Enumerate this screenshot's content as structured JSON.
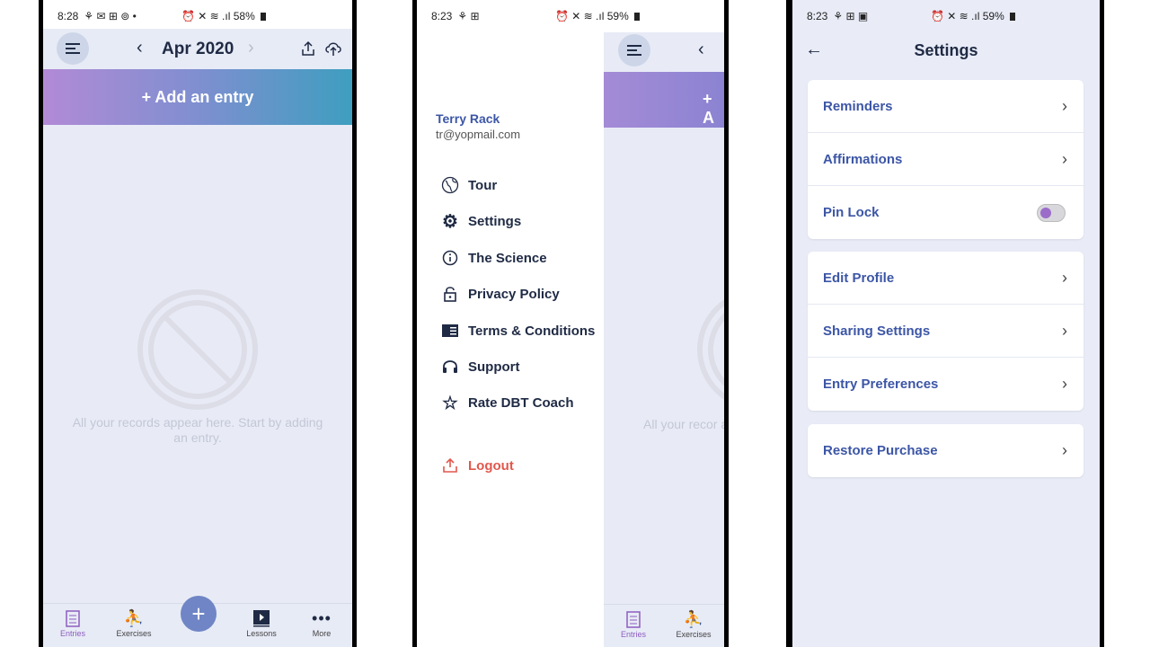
{
  "screen1": {
    "status": {
      "time": "8:28",
      "icons": "⚘ ✉ ⊞ ⊚ •",
      "right": "⏰ ✕ ≋ .ıl 58%"
    },
    "header": {
      "month": "Apr 2020",
      "prev": "‹",
      "next": "›"
    },
    "add_entry": "+ Add an entry",
    "empty_text": "All your records appear here. Start by adding an entry.",
    "nav": {
      "entries": "Entries",
      "exercises": "Exercises",
      "fab": "+",
      "lessons": "Lessons",
      "more": "More"
    }
  },
  "screen2": {
    "status": {
      "time": "8:23",
      "icons": "⚘ ⊞",
      "right": "⏰ ✕ ≋ .ıl 59%"
    },
    "profile": {
      "name": "Terry Rack",
      "email": "tr@yopmail.com"
    },
    "menu": {
      "tour": "Tour",
      "settings": "Settings",
      "science": "The Science",
      "privacy": "Privacy Policy",
      "terms": "Terms & Conditions",
      "support": "Support",
      "rate": "Rate DBT Coach",
      "logout": "Logout"
    },
    "behind": {
      "banner": "+ A",
      "empty_text": "All your recor ad",
      "nav_entries": "Entries",
      "nav_exercises": "Exercises"
    }
  },
  "screen3": {
    "status": {
      "time": "8:23",
      "icons": "⚘ ⊞ ▣",
      "right": "⏰ ✕ ≋ .ıl 59%"
    },
    "title": "Settings",
    "group1": {
      "reminders": "Reminders",
      "affirmations": "Affirmations",
      "pin_lock": "Pin Lock"
    },
    "group2": {
      "edit_profile": "Edit Profile",
      "sharing": "Sharing Settings",
      "entry_prefs": "Entry Preferences"
    },
    "group3": {
      "restore": "Restore Purchase"
    },
    "pin_lock_enabled": false
  },
  "colors": {
    "accent": "#3c56a6",
    "purple": "#8d5dbf",
    "logout": "#e2574c",
    "bg": "#e8ebf6"
  }
}
